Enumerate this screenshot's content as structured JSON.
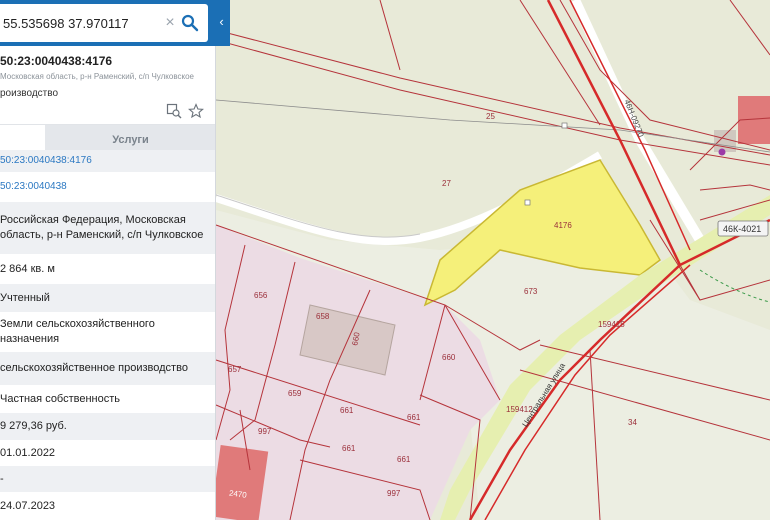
{
  "search": {
    "value": "55.535698 37.970117"
  },
  "parcel": {
    "number": "50:23:0040438:4176",
    "address": "Московская область, р-н Раменский, с/п Чулковское",
    "type": "роизводство"
  },
  "tabs": {
    "services": "Услуги"
  },
  "links": {
    "cadastral_number": "50:23:0040438:4176",
    "quarter": "50:23:0040438"
  },
  "attributes": [
    "Российская Федерация, Московская область, р-н Раменский, с/п Чулковское",
    "2 864 кв. м",
    "Учтенный",
    "Земли сельскохозяйственного назначения",
    "сельскохозяйственное производство",
    "Частная собственность",
    "9 279,36 руб.",
    "01.01.2022",
    "-",
    "24.07.2023"
  ],
  "map": {
    "road_label": "46Н-09270",
    "road_badge": "46К-4021",
    "street_label": "Центральная улица",
    "parcel_labels": [
      "25",
      "27",
      "4176",
      "673",
      "656",
      "658",
      "660",
      "660",
      "657",
      "659",
      "661",
      "661",
      "661",
      "997",
      "661",
      "997",
      "2470",
      "159415",
      "159412",
      "34"
    ],
    "colors": {
      "background": "#e8ead8",
      "selected_parcel": "#f5f07a",
      "private_parcels": "#ecdce4",
      "boundary": "#b5343b",
      "road": "#d62a2a",
      "building": "#e07a7a"
    }
  }
}
